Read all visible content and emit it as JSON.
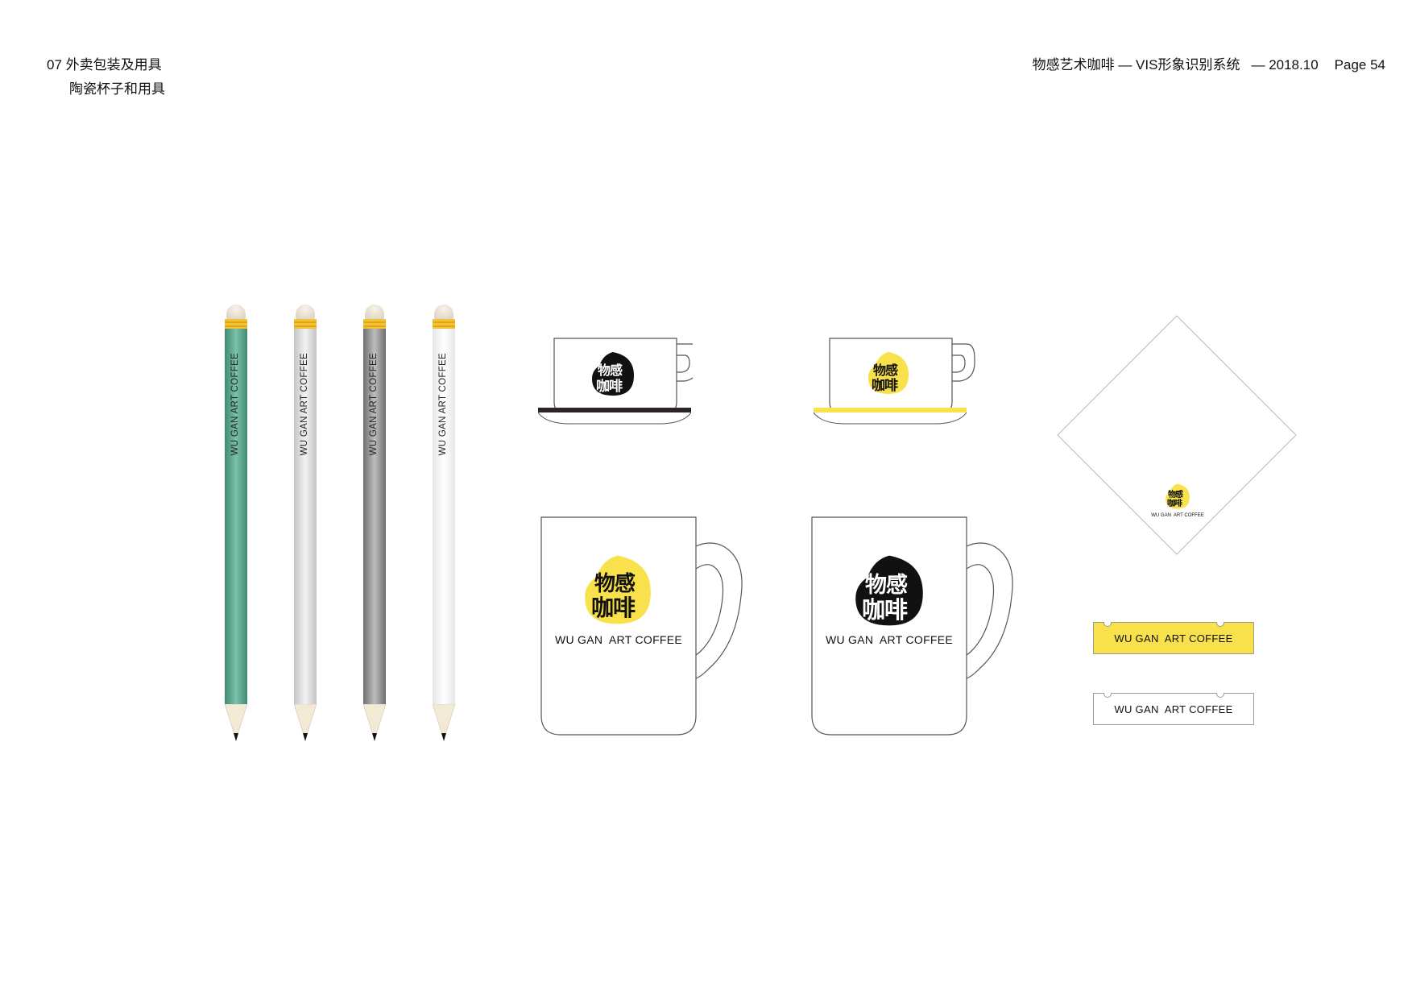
{
  "header": {
    "section": "07 外卖包装及用具",
    "subsection": "陶瓷杯子和用具",
    "title": "物感艺术咖啡 — VIS形象识别系统",
    "date": "— 2018.10",
    "page": "Page 54"
  },
  "brand": {
    "logo_line1": "物感",
    "logo_line2": "咖啡",
    "wordmark": "WU GAN  ART COFFEE",
    "pencil_text": "WU GAN  ART COFFEE",
    "colors": {
      "yellow": "#f8e14a",
      "black": "#111111",
      "green": "#5aa58e",
      "silver": "#d4d4d4",
      "gray": "#8a8a8a",
      "white": "#f4f4f4"
    }
  },
  "pencils": [
    {
      "name": "green",
      "color": "#5aa58e"
    },
    {
      "name": "silver",
      "color": "#d4d4d4"
    },
    {
      "name": "gray",
      "color": "#8a8a8a"
    },
    {
      "name": "white",
      "color": "#f4f4f4"
    }
  ],
  "tags": [
    {
      "label": "WU GAN  ART COFFEE",
      "fill": "#f8e14a"
    },
    {
      "label": "WU GAN  ART COFFEE",
      "fill": "#ffffff"
    }
  ]
}
